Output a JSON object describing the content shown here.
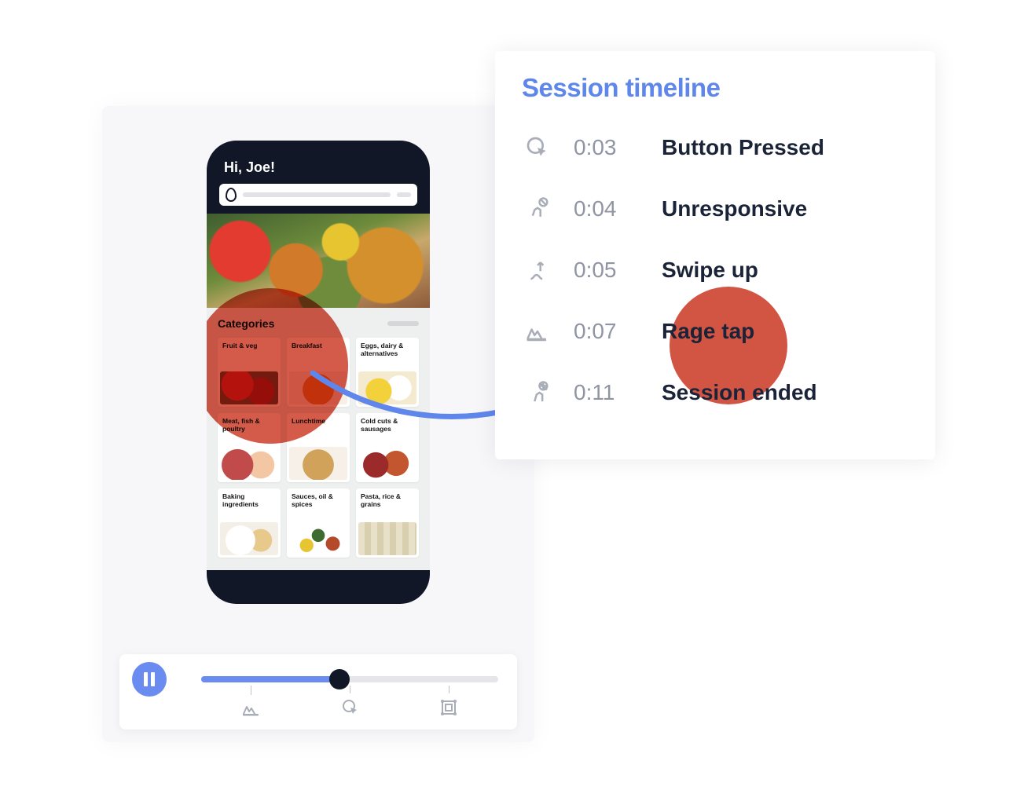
{
  "colors": {
    "accent": "#6a8cf0",
    "rage": "#d04c3a",
    "ink": "#1a2337",
    "muted": "#8f95a3",
    "panel": "#f7f7f9"
  },
  "phone": {
    "greeting": "Hi, Joe!",
    "categories_heading": "Categories",
    "categories": [
      {
        "label": "Fruit & veg"
      },
      {
        "label": "Breakfast"
      },
      {
        "label": "Eggs, dairy & alternatives"
      },
      {
        "label": "Meat, fish & poultry"
      },
      {
        "label": "Lunchtime"
      },
      {
        "label": "Cold cuts & sausages"
      },
      {
        "label": "Baking ingredients"
      },
      {
        "label": "Sauces, oil & spices"
      },
      {
        "label": "Pasta, rice & grains"
      }
    ]
  },
  "timeline": {
    "title": "Session timeline",
    "events": [
      {
        "icon": "pointer-click-icon",
        "time": "0:03",
        "label": "Button Pressed"
      },
      {
        "icon": "unresponsive-icon",
        "time": "0:04",
        "label": "Unresponsive"
      },
      {
        "icon": "swipe-up-icon",
        "time": "0:05",
        "label": "Swipe up"
      },
      {
        "icon": "rage-tap-icon",
        "time": "0:07",
        "label": "Rage tap"
      },
      {
        "icon": "session-ended-icon",
        "time": "0:11",
        "label": "Session ended"
      }
    ]
  },
  "playback": {
    "state": "playing",
    "progress": 0.45
  }
}
